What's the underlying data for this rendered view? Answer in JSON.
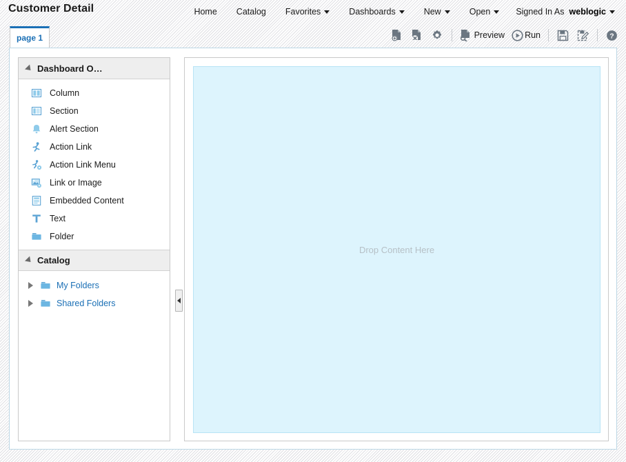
{
  "header": {
    "title": "Customer Detail",
    "nav": [
      {
        "label": "Home",
        "icon": "",
        "has_caret": false
      },
      {
        "label": "Catalog",
        "icon": "",
        "has_caret": false
      },
      {
        "label": "Favorites",
        "icon": "chevron-down-icon",
        "has_caret": true
      },
      {
        "label": "Dashboards",
        "icon": "chevron-down-icon",
        "has_caret": true
      },
      {
        "label": "New",
        "icon": "chevron-down-icon",
        "has_caret": true
      },
      {
        "label": "Open",
        "icon": "chevron-down-icon",
        "has_caret": true
      }
    ],
    "signed_in_label": "Signed In As",
    "signed_in_user": "weblogic"
  },
  "tabs": [
    {
      "label": "page 1",
      "active": true
    }
  ],
  "toolbar": {
    "add_page_title": "Add Dashboard Page",
    "delete_page_title": "Delete Dashboard Page",
    "tools_title": "Tools",
    "preview_label": "Preview",
    "run_label": "Run",
    "save_title": "Save",
    "save_as_title": "Save As",
    "help_title": "Help"
  },
  "sidebar": {
    "objects_panel": {
      "title": "Dashboard O…",
      "full_title": "Dashboard Objects",
      "expanded": true,
      "items": [
        {
          "label": "Column",
          "icon": "column-icon"
        },
        {
          "label": "Section",
          "icon": "section-icon"
        },
        {
          "label": "Alert Section",
          "icon": "alert-section-icon"
        },
        {
          "label": "Action Link",
          "icon": "action-link-icon"
        },
        {
          "label": "Action Link Menu",
          "icon": "action-link-menu-icon"
        },
        {
          "label": "Link or Image",
          "icon": "link-or-image-icon"
        },
        {
          "label": "Embedded Content",
          "icon": "embedded-content-icon"
        },
        {
          "label": "Text",
          "icon": "text-icon"
        },
        {
          "label": "Folder",
          "icon": "folder-icon"
        }
      ]
    },
    "catalog_panel": {
      "title": "Catalog",
      "expanded": true,
      "items": [
        {
          "label": "My Folders",
          "icon": "folder-icon",
          "expanded": false
        },
        {
          "label": "Shared Folders",
          "icon": "folder-icon",
          "expanded": false
        }
      ]
    },
    "splitter_title": "Collapse Pane"
  },
  "canvas": {
    "drop_text": "Drop Content Here"
  },
  "colors": {
    "accent": "#1a6fb5",
    "dropzone_bg": "#ddf4fd",
    "panel_header_bg": "#eeeeee",
    "icon_blue": "#7ab8e0",
    "toolbar_icon": "#6b7681"
  }
}
